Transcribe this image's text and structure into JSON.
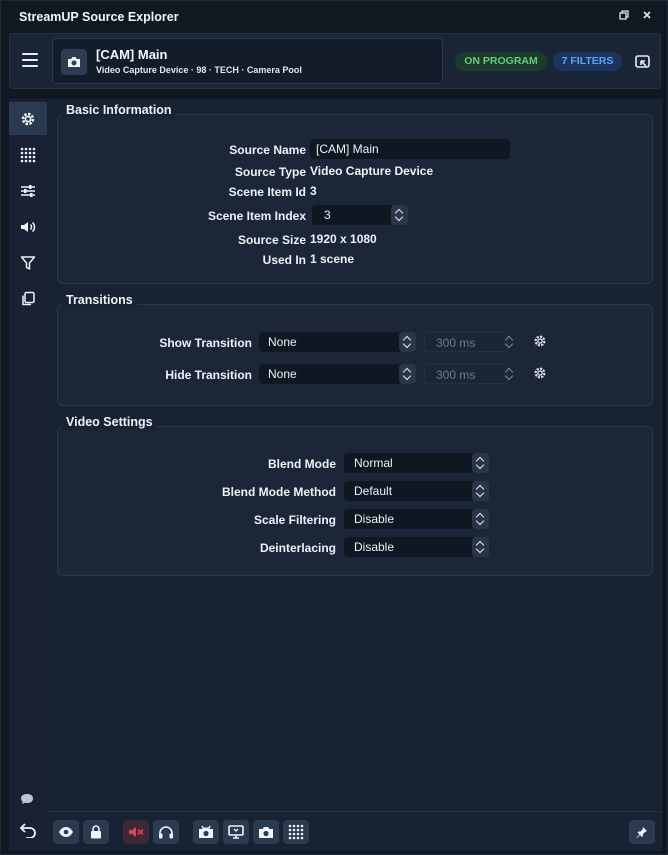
{
  "window": {
    "title": "StreamUP Source Explorer"
  },
  "header": {
    "source_name": "[CAM] Main",
    "source_meta": "Video Capture Device · 98 · TECH · Camera Pool",
    "badge_program": "ON PROGRAM",
    "badge_filters": "7 FILTERS"
  },
  "sidebar": {
    "items": [
      {
        "icon": "gear-icon"
      },
      {
        "icon": "grid-icon"
      },
      {
        "icon": "sliders-icon"
      },
      {
        "icon": "speaker-icon"
      },
      {
        "icon": "filter-icon"
      },
      {
        "icon": "copy-icon"
      }
    ]
  },
  "basic": {
    "title": "Basic Information",
    "source_name_label": "Source Name",
    "source_name_value": "[CAM] Main",
    "source_type_label": "Source Type",
    "source_type_value": "Video Capture Device",
    "scene_item_id_label": "Scene Item Id",
    "scene_item_id_value": "3",
    "scene_item_index_label": "Scene Item Index",
    "scene_item_index_value": "3",
    "source_size_label": "Source Size",
    "source_size_value": "1920 x 1080",
    "used_in_label": "Used In",
    "used_in_value": "1 scene"
  },
  "transitions": {
    "title": "Transitions",
    "show_label": "Show Transition",
    "show_value": "None",
    "show_duration": "300 ms",
    "hide_label": "Hide Transition",
    "hide_value": "None",
    "hide_duration": "300 ms"
  },
  "video": {
    "title": "Video Settings",
    "blend_mode_label": "Blend Mode",
    "blend_mode_value": "Normal",
    "blend_method_label": "Blend Mode Method",
    "blend_method_value": "Default",
    "scale_filtering_label": "Scale Filtering",
    "scale_filtering_value": "Disable",
    "deinterlacing_label": "Deinterlacing",
    "deinterlacing_value": "Disable"
  },
  "colors": {
    "accent_green": "#5fcf7e",
    "accent_blue": "#58a6ff",
    "muted_red": "#e0404f"
  }
}
